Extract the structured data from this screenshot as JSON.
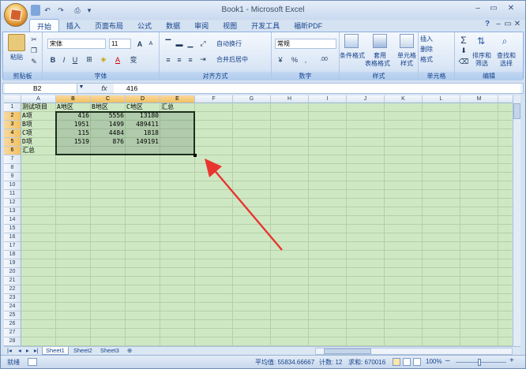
{
  "app": {
    "title": "Book1 - Microsoft Excel"
  },
  "quick_access": {
    "undo": "↶",
    "redo": "↷",
    "print": "⎙",
    "more": "▾"
  },
  "window_controls": {
    "minimize": "–",
    "restore": "▭",
    "close": "✕",
    "ribbon_min": "–",
    "ribbon_restore": "▭",
    "ribbon_close": "✕",
    "help": "?"
  },
  "tabs": [
    "开始",
    "插入",
    "页面布局",
    "公式",
    "数据",
    "审阅",
    "视图",
    "开发工具",
    "福昕PDF"
  ],
  "ribbon": {
    "clipboard": {
      "paste": "粘贴",
      "label": "剪贴板"
    },
    "font": {
      "name": "宋体",
      "size": "11",
      "label": "字体",
      "bold": "B",
      "italic": "I",
      "underline": "U",
      "grow": "A",
      "shrink": "A",
      "color_letter": "A",
      "wen": "变"
    },
    "alignment": {
      "wrap": "自动换行",
      "merge": "合并后居中",
      "label": "对齐方式"
    },
    "number": {
      "format": "常规",
      "percent": "%",
      "comma": ",",
      "label": "数字",
      "inc_dec": ".00"
    },
    "styles": {
      "conditional": "条件格式",
      "table": "套用",
      "table2": "表格格式",
      "cell": "单元格",
      "cell2": "样式",
      "label": "样式"
    },
    "cells": {
      "insert": "插入",
      "delete": "删除",
      "format": "格式",
      "label": "单元格"
    },
    "editing": {
      "sum": "Σ",
      "sort": "排序和",
      "sort2": "筛选",
      "find": "查找和",
      "find2": "选择",
      "label": "编辑"
    }
  },
  "formula_bar": {
    "name_box": "B2",
    "fx": "fx",
    "value": "416"
  },
  "columns": [
    "A",
    "B",
    "C",
    "D",
    "E",
    "F",
    "G",
    "H",
    "I",
    "J",
    "K",
    "L",
    "M",
    "N"
  ],
  "rows": [
    "1",
    "2",
    "3",
    "4",
    "5",
    "6",
    "7",
    "8",
    "9",
    "10",
    "11",
    "12",
    "13",
    "14",
    "15",
    "16",
    "17",
    "18",
    "19",
    "20",
    "21",
    "22",
    "23",
    "24",
    "25",
    "26",
    "27",
    "28"
  ],
  "cells": {
    "A1": "测试项目",
    "B1": "A地区",
    "C1": "B地区",
    "D1": "C地区",
    "E1": "汇总",
    "A2": "A项",
    "B2": "416",
    "C2": "5556",
    "D2": "13180",
    "A3": "B项",
    "B3": "1951",
    "C3": "1499",
    "D3": "489411",
    "A4": "C项",
    "B4": "115",
    "C4": "4484",
    "D4": "1818",
    "A5": "D项",
    "B5": "1519",
    "C5": "876",
    "D5": "149191",
    "A6": "汇总"
  },
  "sheets": [
    "Sheet1",
    "Sheet2",
    "Sheet3"
  ],
  "sheet_nav": [
    "|◂",
    "◂",
    "▸",
    "▸|"
  ],
  "status": {
    "ready": "就绪",
    "average": "平均值: 55834.66667",
    "count": "计数: 12",
    "sum": "求和: 670016",
    "zoom": "100%",
    "zoom_minus": "–",
    "zoom_plus": "+"
  },
  "colors": {
    "grid_bg": "#cfe8c4",
    "selection_border": "#1d2d1d",
    "arrow": "#e8362f"
  }
}
